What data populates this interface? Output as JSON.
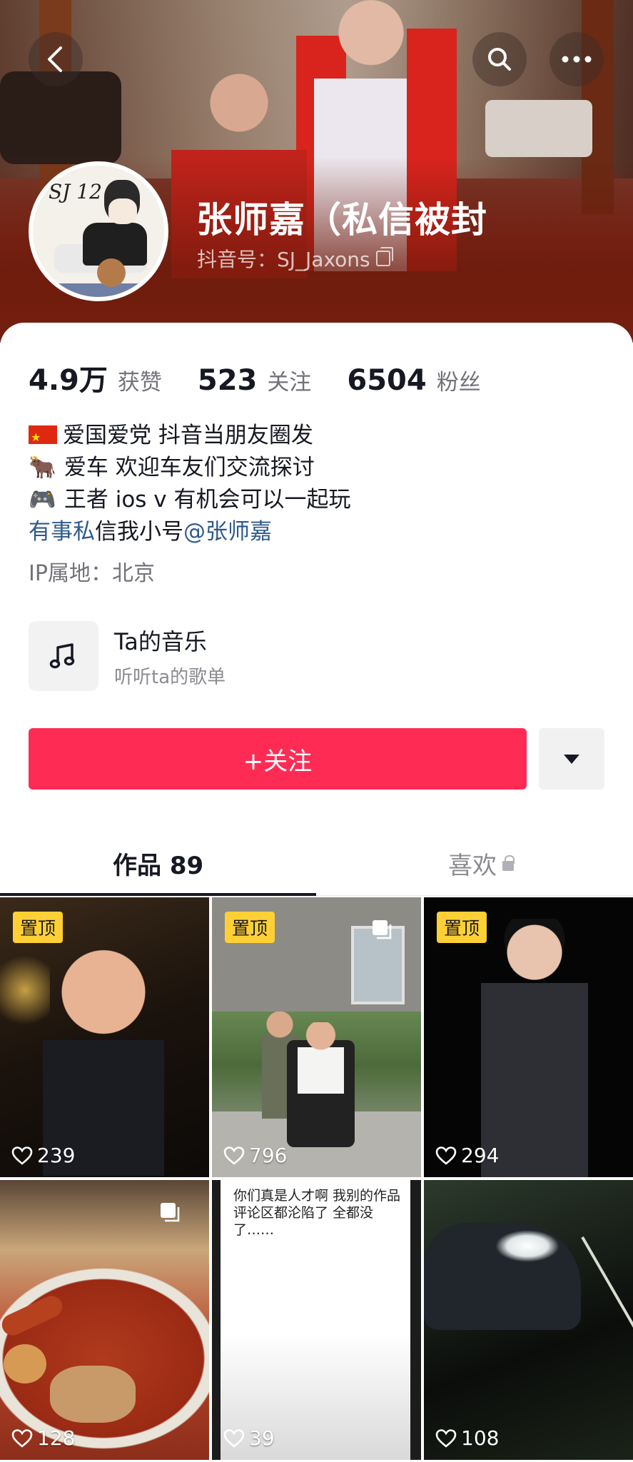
{
  "header": {
    "name": "张师嘉（私信被封",
    "douyin_id": "抖音号：SJ_Jaxons",
    "avatar_text": "SJ 12"
  },
  "stats": [
    {
      "value": "4.9万",
      "label": "获赞"
    },
    {
      "value": "523",
      "label": "关注"
    },
    {
      "value": "6504",
      "label": "粉丝"
    }
  ],
  "bio": {
    "line1": "爱国爱党 抖音当朋友圈发",
    "line2_emoji": "🐂",
    "line2": "爱车 欢迎车友们交流探讨",
    "line3_emoji": "🎮",
    "line3": "王者 ios v 有机会可以一起玩",
    "line4_link1": "有事私",
    "line4_text": "信我小号",
    "line4_link2": "@张师嘉",
    "ip": "IP属地：北京"
  },
  "music": {
    "title": "Ta的音乐",
    "subtitle": "听听ta的歌单"
  },
  "actions": {
    "follow_label": "+关注"
  },
  "tabs": {
    "works": "作品 89",
    "likes": "喜欢"
  },
  "grid": {
    "pin_label": "置顶",
    "items": [
      {
        "likes": "239"
      },
      {
        "likes": "796"
      },
      {
        "likes": "294"
      },
      {
        "likes": "128"
      },
      {
        "likes": "39",
        "text": "你们真是人才啊 我别的作品评论区都沦陷了 全都没了……"
      },
      {
        "likes": "108"
      }
    ]
  },
  "colors": {
    "accent": "#fe2c55",
    "pin": "#ffd035",
    "link": "#2e5a8a"
  },
  "icons": [
    "back-icon",
    "search-icon",
    "more-icon",
    "copy-icon",
    "music-note-icon",
    "dropdown-triangle-icon",
    "lock-icon",
    "heart-icon",
    "multi-image-icon",
    "china-flag-icon"
  ]
}
